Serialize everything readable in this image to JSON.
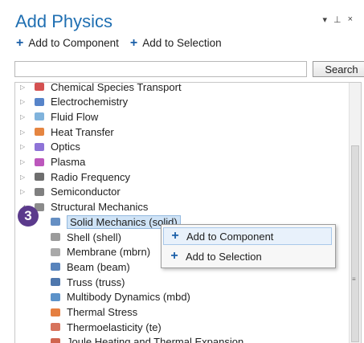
{
  "header": {
    "title": "Add Physics",
    "controls": [
      "▾",
      "⊥",
      "×"
    ]
  },
  "toolbar": {
    "add_to_component": "Add to Component",
    "add_to_selection": "Add to Selection"
  },
  "search": {
    "placeholder": "",
    "button": "Search"
  },
  "tree": {
    "items": [
      {
        "label": "Chemical Species Transport",
        "icon": "chemical-icon",
        "expander": "▷"
      },
      {
        "label": "Electrochemistry",
        "icon": "electrochemistry-icon",
        "expander": "▷"
      },
      {
        "label": "Fluid Flow",
        "icon": "fluid-flow-icon",
        "expander": "▷"
      },
      {
        "label": "Heat Transfer",
        "icon": "heat-transfer-icon",
        "expander": "▷"
      },
      {
        "label": "Optics",
        "icon": "optics-icon",
        "expander": "▷"
      },
      {
        "label": "Plasma",
        "icon": "plasma-icon",
        "expander": "▷"
      },
      {
        "label": "Radio Frequency",
        "icon": "radio-frequency-icon",
        "expander": "▷"
      },
      {
        "label": "Semiconductor",
        "icon": "semiconductor-icon",
        "expander": "▷"
      },
      {
        "label": "Structural Mechanics",
        "icon": "structural-mechanics-icon",
        "expander": "◢"
      },
      {
        "label": "Solid Mechanics (solid)",
        "icon": "solid-mechanics-icon",
        "selected": true
      },
      {
        "label": "Shell (shell)",
        "icon": "shell-icon"
      },
      {
        "label": "Membrane (mbrn)",
        "icon": "membrane-icon"
      },
      {
        "label": "Beam (beam)",
        "icon": "beam-icon"
      },
      {
        "label": "Truss (truss)",
        "icon": "truss-icon"
      },
      {
        "label": "Multibody Dynamics (mbd)",
        "icon": "multibody-icon"
      },
      {
        "label": "Thermal Stress",
        "icon": "thermal-stress-icon"
      },
      {
        "label": "Thermoelasticity (te)",
        "icon": "thermoelasticity-icon"
      },
      {
        "label": "Joule Heating and Thermal Expansion",
        "icon": "joule-heating-icon"
      }
    ]
  },
  "step_badge": "3",
  "context_menu": {
    "items": [
      "Add to Component",
      "Add to Selection"
    ]
  },
  "colors": {
    "title": "#1f6fb2",
    "badge": "#5b3a8c",
    "selection": "#cfe3f6",
    "plus": "#1a5fa8"
  }
}
